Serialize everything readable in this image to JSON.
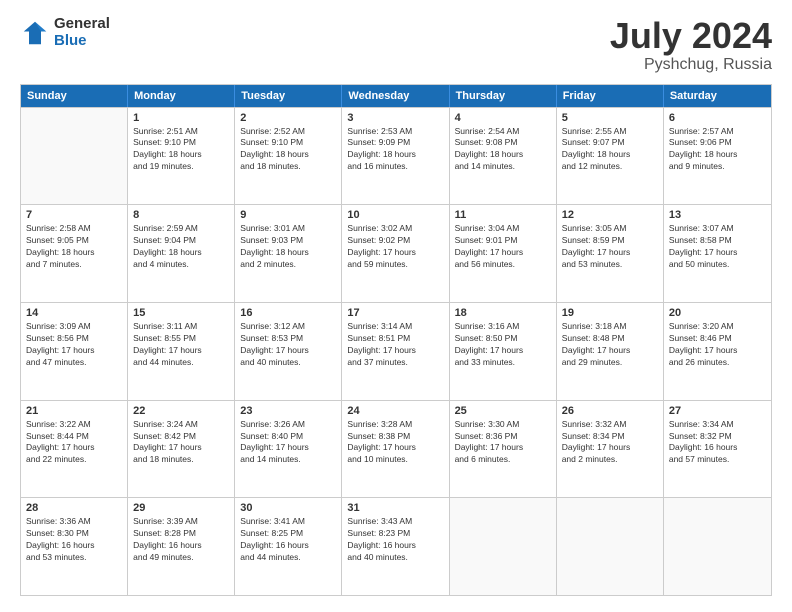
{
  "logo": {
    "general": "General",
    "blue": "Blue"
  },
  "title": {
    "month": "July 2024",
    "location": "Pyshchug, Russia"
  },
  "days": [
    "Sunday",
    "Monday",
    "Tuesday",
    "Wednesday",
    "Thursday",
    "Friday",
    "Saturday"
  ],
  "weeks": [
    [
      {
        "day": "",
        "info": ""
      },
      {
        "day": "1",
        "info": "Sunrise: 2:51 AM\nSunset: 9:10 PM\nDaylight: 18 hours\nand 19 minutes."
      },
      {
        "day": "2",
        "info": "Sunrise: 2:52 AM\nSunset: 9:10 PM\nDaylight: 18 hours\nand 18 minutes."
      },
      {
        "day": "3",
        "info": "Sunrise: 2:53 AM\nSunset: 9:09 PM\nDaylight: 18 hours\nand 16 minutes."
      },
      {
        "day": "4",
        "info": "Sunrise: 2:54 AM\nSunset: 9:08 PM\nDaylight: 18 hours\nand 14 minutes."
      },
      {
        "day": "5",
        "info": "Sunrise: 2:55 AM\nSunset: 9:07 PM\nDaylight: 18 hours\nand 12 minutes."
      },
      {
        "day": "6",
        "info": "Sunrise: 2:57 AM\nSunset: 9:06 PM\nDaylight: 18 hours\nand 9 minutes."
      }
    ],
    [
      {
        "day": "7",
        "info": "Sunrise: 2:58 AM\nSunset: 9:05 PM\nDaylight: 18 hours\nand 7 minutes."
      },
      {
        "day": "8",
        "info": "Sunrise: 2:59 AM\nSunset: 9:04 PM\nDaylight: 18 hours\nand 4 minutes."
      },
      {
        "day": "9",
        "info": "Sunrise: 3:01 AM\nSunset: 9:03 PM\nDaylight: 18 hours\nand 2 minutes."
      },
      {
        "day": "10",
        "info": "Sunrise: 3:02 AM\nSunset: 9:02 PM\nDaylight: 17 hours\nand 59 minutes."
      },
      {
        "day": "11",
        "info": "Sunrise: 3:04 AM\nSunset: 9:01 PM\nDaylight: 17 hours\nand 56 minutes."
      },
      {
        "day": "12",
        "info": "Sunrise: 3:05 AM\nSunset: 8:59 PM\nDaylight: 17 hours\nand 53 minutes."
      },
      {
        "day": "13",
        "info": "Sunrise: 3:07 AM\nSunset: 8:58 PM\nDaylight: 17 hours\nand 50 minutes."
      }
    ],
    [
      {
        "day": "14",
        "info": "Sunrise: 3:09 AM\nSunset: 8:56 PM\nDaylight: 17 hours\nand 47 minutes."
      },
      {
        "day": "15",
        "info": "Sunrise: 3:11 AM\nSunset: 8:55 PM\nDaylight: 17 hours\nand 44 minutes."
      },
      {
        "day": "16",
        "info": "Sunrise: 3:12 AM\nSunset: 8:53 PM\nDaylight: 17 hours\nand 40 minutes."
      },
      {
        "day": "17",
        "info": "Sunrise: 3:14 AM\nSunset: 8:51 PM\nDaylight: 17 hours\nand 37 minutes."
      },
      {
        "day": "18",
        "info": "Sunrise: 3:16 AM\nSunset: 8:50 PM\nDaylight: 17 hours\nand 33 minutes."
      },
      {
        "day": "19",
        "info": "Sunrise: 3:18 AM\nSunset: 8:48 PM\nDaylight: 17 hours\nand 29 minutes."
      },
      {
        "day": "20",
        "info": "Sunrise: 3:20 AM\nSunset: 8:46 PM\nDaylight: 17 hours\nand 26 minutes."
      }
    ],
    [
      {
        "day": "21",
        "info": "Sunrise: 3:22 AM\nSunset: 8:44 PM\nDaylight: 17 hours\nand 22 minutes."
      },
      {
        "day": "22",
        "info": "Sunrise: 3:24 AM\nSunset: 8:42 PM\nDaylight: 17 hours\nand 18 minutes."
      },
      {
        "day": "23",
        "info": "Sunrise: 3:26 AM\nSunset: 8:40 PM\nDaylight: 17 hours\nand 14 minutes."
      },
      {
        "day": "24",
        "info": "Sunrise: 3:28 AM\nSunset: 8:38 PM\nDaylight: 17 hours\nand 10 minutes."
      },
      {
        "day": "25",
        "info": "Sunrise: 3:30 AM\nSunset: 8:36 PM\nDaylight: 17 hours\nand 6 minutes."
      },
      {
        "day": "26",
        "info": "Sunrise: 3:32 AM\nSunset: 8:34 PM\nDaylight: 17 hours\nand 2 minutes."
      },
      {
        "day": "27",
        "info": "Sunrise: 3:34 AM\nSunset: 8:32 PM\nDaylight: 16 hours\nand 57 minutes."
      }
    ],
    [
      {
        "day": "28",
        "info": "Sunrise: 3:36 AM\nSunset: 8:30 PM\nDaylight: 16 hours\nand 53 minutes."
      },
      {
        "day": "29",
        "info": "Sunrise: 3:39 AM\nSunset: 8:28 PM\nDaylight: 16 hours\nand 49 minutes."
      },
      {
        "day": "30",
        "info": "Sunrise: 3:41 AM\nSunset: 8:25 PM\nDaylight: 16 hours\nand 44 minutes."
      },
      {
        "day": "31",
        "info": "Sunrise: 3:43 AM\nSunset: 8:23 PM\nDaylight: 16 hours\nand 40 minutes."
      },
      {
        "day": "",
        "info": ""
      },
      {
        "day": "",
        "info": ""
      },
      {
        "day": "",
        "info": ""
      }
    ]
  ]
}
